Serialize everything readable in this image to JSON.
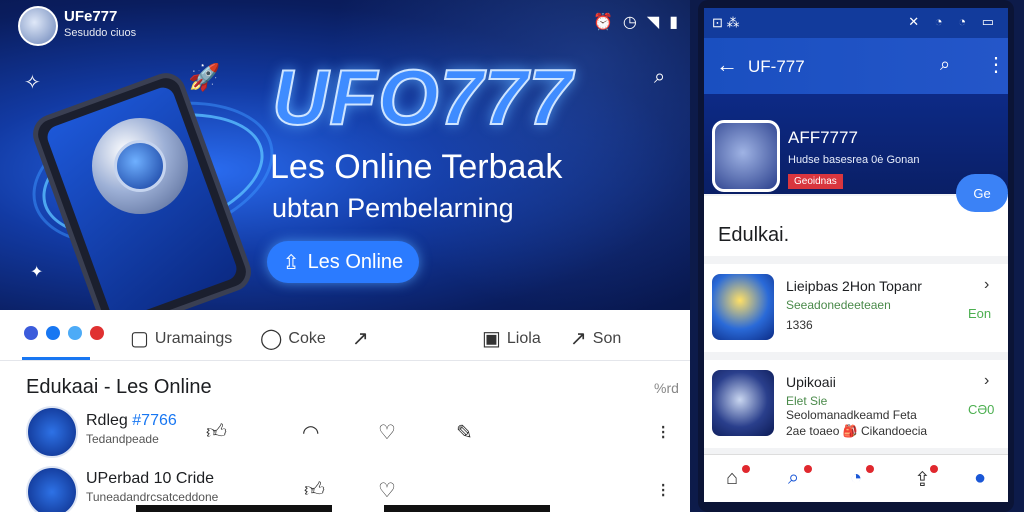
{
  "left": {
    "header": {
      "user_name": "UFe777",
      "user_sub": "Sesuddo ciuos",
      "status_icons": [
        "alarm-icon",
        "clock-icon",
        "wifi-icon",
        "battery-icon"
      ]
    },
    "hero": {
      "brand": "UFO777",
      "tagline": "Les Online Terbaak",
      "subtagline": "ubtan Pembelarning",
      "cta_label": "Les Online",
      "cta_icon": "⇫"
    },
    "tabs": [
      {
        "label": "Uramaings",
        "icon": "▢"
      },
      {
        "label": "Coke",
        "icon": "◯"
      },
      {
        "label": "",
        "icon": "↗"
      },
      {
        "label": "Liola",
        "icon": "▣"
      },
      {
        "label": "Son",
        "icon": "↗"
      }
    ],
    "section": {
      "title": "Edukaai - Les Online",
      "more": "%rd"
    },
    "rows": [
      {
        "title": "Rdleg",
        "title_accent": "#7766",
        "sub": "Tedandpeade"
      },
      {
        "title": "UPerbad 10 Cride",
        "title_accent": "",
        "sub": "Tuneadandrcsatceddone"
      }
    ]
  },
  "right": {
    "status": {
      "left": "⊡ ⁂",
      "right": "✕ ◔ ◔ ▭"
    },
    "appbar": {
      "title": "UF-777"
    },
    "profile": {
      "name": "AFF7777",
      "sub": "Hudse basesrea 0ė Gonan",
      "badge": "Geoidnas"
    },
    "fab": "Ge",
    "section_title": "Edulkai.",
    "cards": [
      {
        "title": "Lieipbas 2Hon Topanr",
        "sub": "Seeadonedeeteaen",
        "meta": "1336",
        "price": "Eon"
      },
      {
        "title": "Upikoaii",
        "sub": "Elet Sie",
        "meta": "Seolomanadkeamd Feta",
        "meta2": "2ae toaeo 🎒 Cikandoecia",
        "price": "CƏ0"
      }
    ]
  },
  "colors": {
    "accent": "#1877f2",
    "hero_dark": "#0a1d5e",
    "badge_red": "#d9363e",
    "price_green": "#4caf50"
  }
}
